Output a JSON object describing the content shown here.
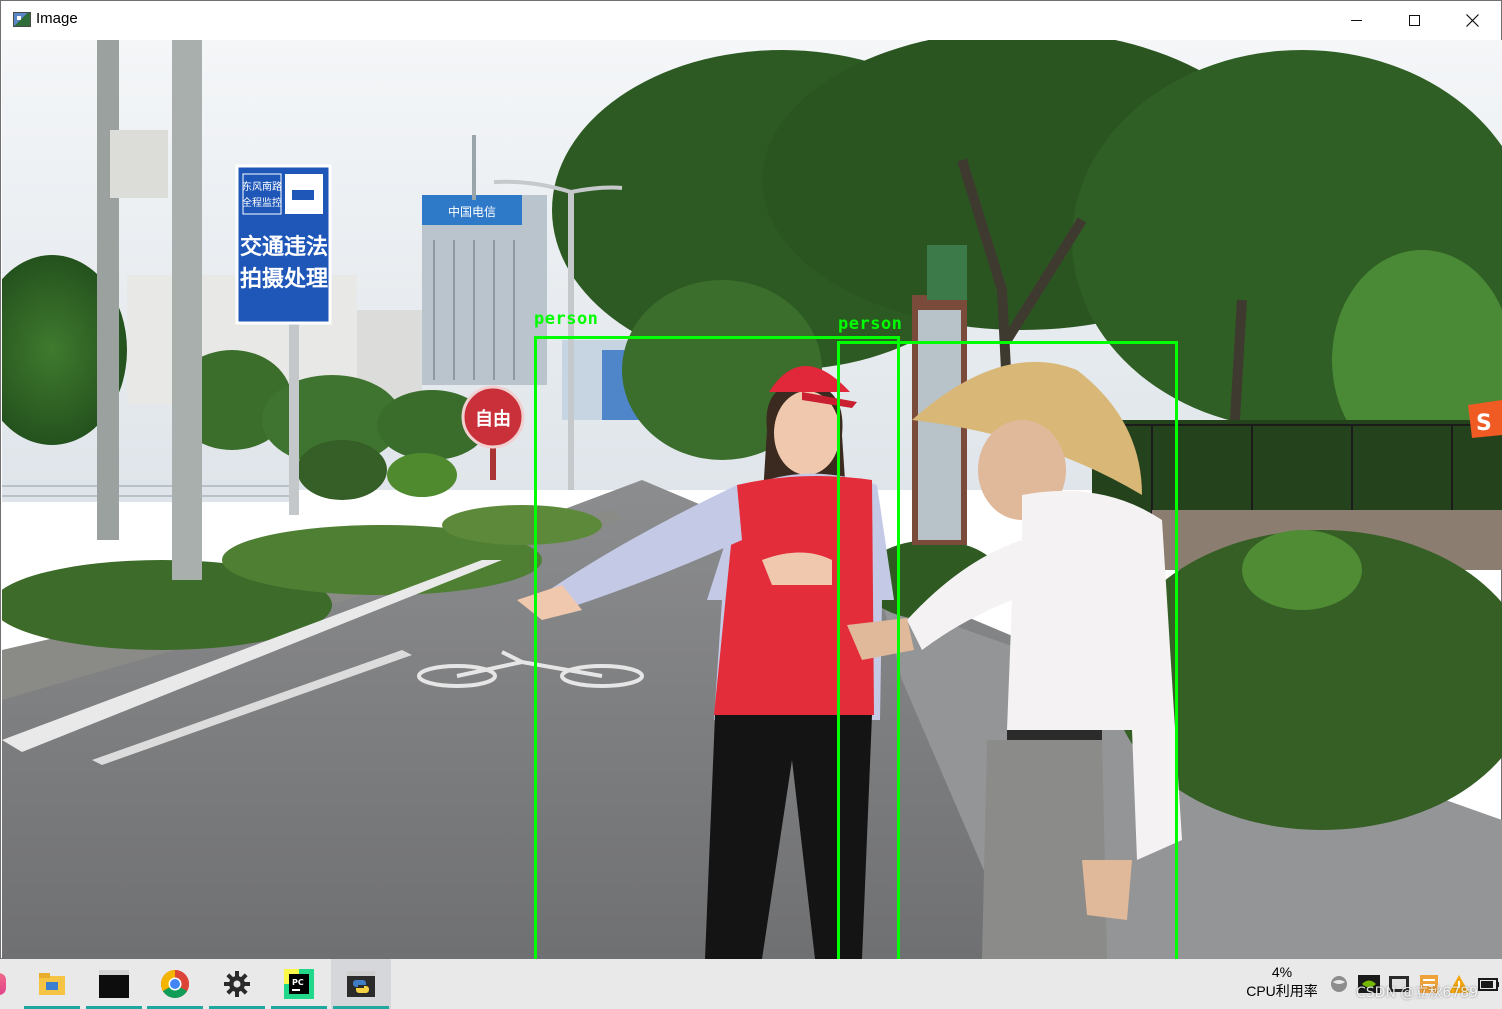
{
  "window": {
    "title": "Image",
    "minimize_symbol": "—",
    "maximize_symbol": "☐",
    "close_symbol": "✕"
  },
  "detections": [
    {
      "label": "person"
    },
    {
      "label": "person"
    }
  ],
  "scene": {
    "sign_line1": "交通违法",
    "sign_line2": "拍摄处理",
    "sign_small1": "东风南路",
    "sign_small2": "全程监控",
    "round_sign": "自由",
    "building_sign": "中国电信"
  },
  "taskbar": {
    "apps": [
      {
        "name": "file-explorer-icon"
      },
      {
        "name": "terminal-icon"
      },
      {
        "name": "chrome-icon"
      },
      {
        "name": "settings-gear-icon"
      },
      {
        "name": "pycharm-icon",
        "text": "PC"
      },
      {
        "name": "python-icon"
      }
    ],
    "cpu_value": "4%",
    "cpu_label": "CPU利用率"
  },
  "watermark": "CSDN @立秋6789",
  "colors": {
    "detection_box": "#00ff00",
    "taskbar_bg": "#e9e9ea",
    "taskbar_indicator": "#1fa89f"
  }
}
